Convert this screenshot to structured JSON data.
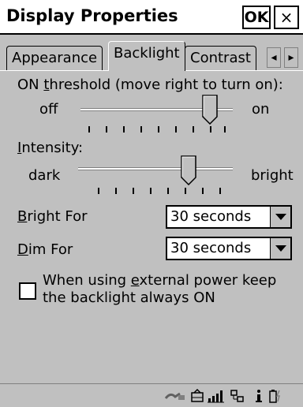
{
  "window": {
    "title": "Display Properties",
    "ok_label": "OK",
    "close_label": "×"
  },
  "tabs": [
    {
      "label": "Appearance",
      "active": false
    },
    {
      "label": "Backlight",
      "active": true
    },
    {
      "label": "Contrast",
      "active": false
    }
  ],
  "tab_scroll": {
    "left": "◂",
    "right": "▸"
  },
  "threshold": {
    "label_pre": "ON ",
    "label_u": "t",
    "label_post": "hreshold (move right to turn on):",
    "min_label": "off",
    "max_label": "on",
    "value": 0.85
  },
  "intensity": {
    "label_u": "I",
    "label_post": "ntensity:",
    "min_label": "dark",
    "max_label": "bright",
    "value": 0.71
  },
  "bright_for": {
    "label_u": "B",
    "label_post": "right For",
    "value": "30 seconds"
  },
  "dim_for": {
    "label_u": "D",
    "label_post": "im For",
    "value": "30 seconds"
  },
  "external_power": {
    "line1_pre": "When using ",
    "line1_u": "e",
    "line1_post": "xternal power keep",
    "line2": "the backlight always ON",
    "checked": false
  },
  "tray": {
    "icons": [
      "connectivity-icon",
      "keyboard-icon",
      "signal-icon",
      "network-icon",
      "info-icon",
      "battery-icon"
    ]
  }
}
